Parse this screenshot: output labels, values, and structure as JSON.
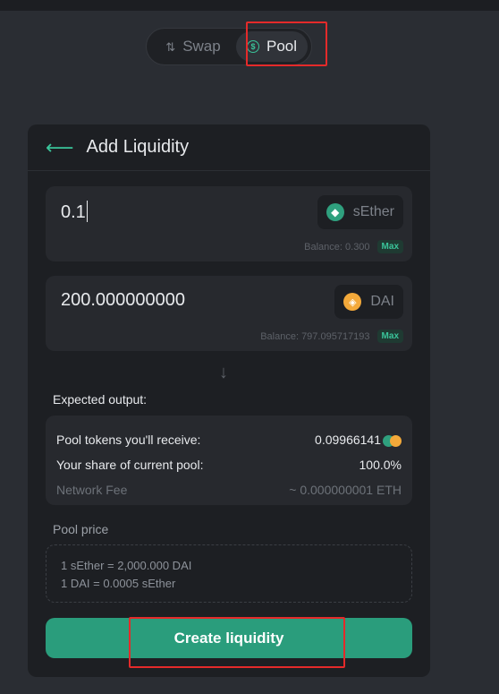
{
  "tabs": [
    {
      "label": "Swap",
      "icon": "swap-arrows-icon",
      "active": false
    },
    {
      "label": "Pool",
      "icon": "dollar-circle-icon",
      "active": true
    }
  ],
  "card": {
    "title": "Add Liquidity",
    "input_a": {
      "value": "0.1",
      "token": "sEther",
      "balance": "Balance: 0.300",
      "max": "Max"
    },
    "input_b": {
      "value": "200.000000000",
      "token": "DAI",
      "balance": "Balance: 797.095717193",
      "max": "Max"
    },
    "expected_label": "Expected output:",
    "output": {
      "pool_tokens_label": "Pool tokens you'll receive:",
      "pool_tokens_value": "0.09966141",
      "share_label": "Your share of current pool:",
      "share_value": "100.0%",
      "fee_label": "Network Fee",
      "fee_value": "~ 0.000000001 ETH"
    },
    "pool_price_label": "Pool price",
    "pool_price": {
      "line1": "1 sEther = 2,000.000 DAI",
      "line2": "1 DAI = 0.0005 sEther"
    },
    "create_button": "Create liquidity"
  },
  "colors": {
    "accent": "#2a9d7c",
    "highlight": "#e42a2a",
    "background": "#2a2d33",
    "card": "#1d1f23"
  }
}
